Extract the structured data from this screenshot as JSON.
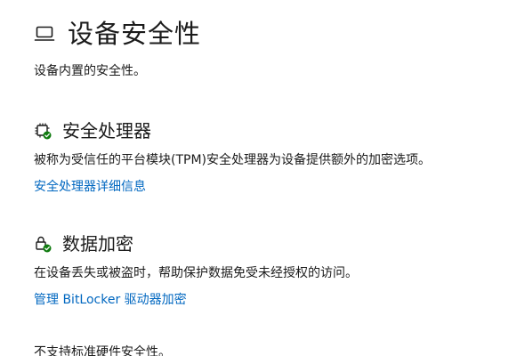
{
  "page": {
    "title": "设备安全性",
    "subtitle": "设备内置的安全性。",
    "icon": "laptop-icon"
  },
  "sections": [
    {
      "title": "安全处理器",
      "description": "被称为受信任的平台模块(TPM)安全处理器为设备提供额外的加密选项。",
      "link": "安全处理器详细信息",
      "icon": "chip-check-icon"
    },
    {
      "title": "数据加密",
      "description": "在设备丢失或被盗时，帮助保护数据免受未经授权的访问。",
      "link": "管理 BitLocker 驱动器加密",
      "icon": "lock-check-icon"
    }
  ],
  "footer": {
    "text": "不支持标准硬件安全性。"
  },
  "colors": {
    "link": "#0067c0",
    "text": "#1b1b1b",
    "check": "#0f7b0f",
    "background": "#ffffff"
  }
}
